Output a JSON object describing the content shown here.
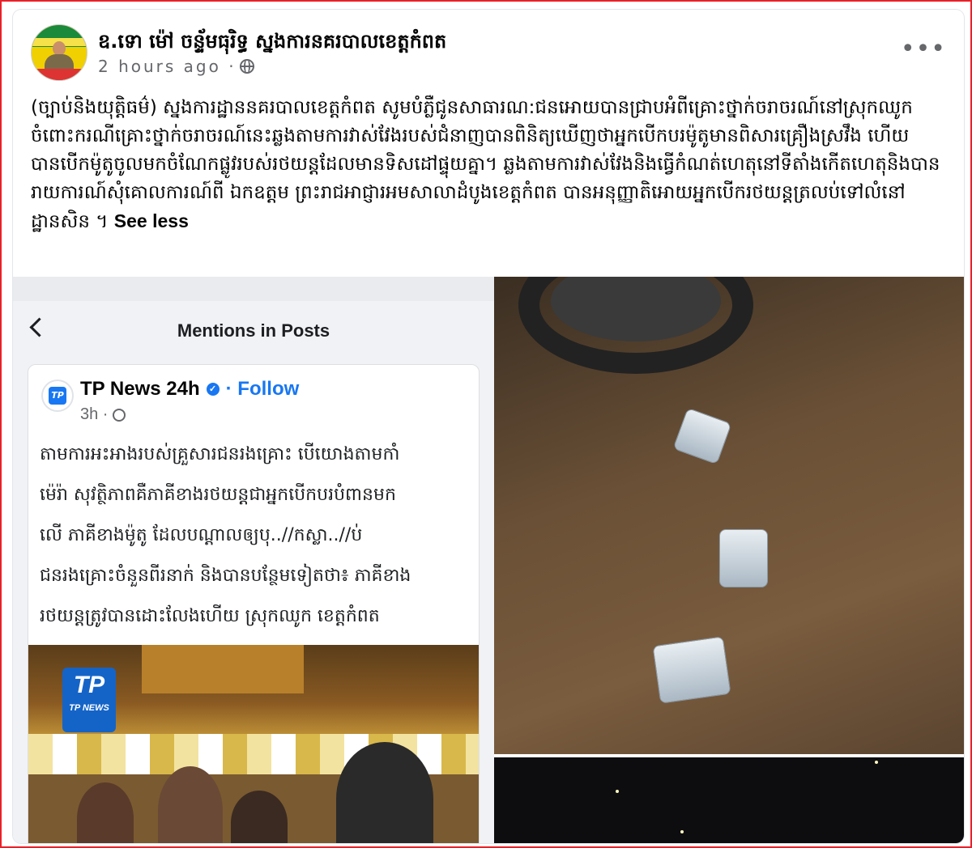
{
  "post": {
    "page_name": "ឧ.ទោ ម៉ៅ ចន្ទ័មធុរិទ្ធ ស្នងការនគរបាលខេត្តកំពត",
    "time": "2 hours ago ·",
    "more": "•••",
    "text": "(ច្បាប់និងយុត្តិធម៌) ស្នងការដ្ឋាននគរបាលខេត្តកំពត សូមបំភ្លឺជូនសាធារណ:ជនអោយបានជ្រាបអំពីគ្រោះថ្នាក់ចរាចរណ៍នៅស្រុកឈូក ចំពោះករណីគ្រោះថ្នាក់ចរាចរណ៍នេះឆ្លងតាមការវាស់វែងរបស់ជំនាញបានពិនិត្យឃើញថាអ្នកបើកបរម៉ូតូមានពិសារគ្រឿងស្រវឹង ហើយបានបើកម៉ូតូចូលមកចំណែកផ្លូវរបស់រថយន្តដែលមានទិសដៅផ្ទុយគ្នា។ ឆ្លងតាមការវាស់វែងនិងធ្វើកំណត់ហេតុនៅទីតាំងកើតហេតុនិងបានរាយការណ៍សុំគោលការណ៍ពី ឯកឧត្តម ព្រះរាជអាជ្ញារអមសាលាដំបូងខេត្តកំពត បានអនុញ្ញាតិអោយអ្នកបើករថយន្តត្រលប់ទៅលំនៅដ្ឋានសិន ។",
    "see_less": "See less"
  },
  "screenshot": {
    "header_title": "Mentions in Posts",
    "source_name": "TP News 24h",
    "verified": "✓",
    "follow": "· Follow",
    "time": "3h ·",
    "logo_text": "TP",
    "text_lines": [
      "តាមការអះអាងរបស់គ្រួសារជនរងគ្រោះ បើយោងតាមកាំ",
      "ម៉េរ៉ា សុវត្ថិភាពគឺភាគីខាងរថយន្តជាអ្នកបើកបរបំពានមក",
      "លើ ភាគីខាងម៉ូតូ ដែលបណ្តាលឲ្យបុ..//កស្លា..//ប់",
      "ជនរងគ្រោះចំនួនពីរនាក់ និងបានបន្ថែមទៀតថា៖ ភាគីខាង",
      "រថយន្តត្រូវបានដោះលែងហើយ  ស្រុកឈូក ខេត្តកំពត"
    ],
    "sign_big": "TP",
    "sign_small": "TP NEWS"
  }
}
